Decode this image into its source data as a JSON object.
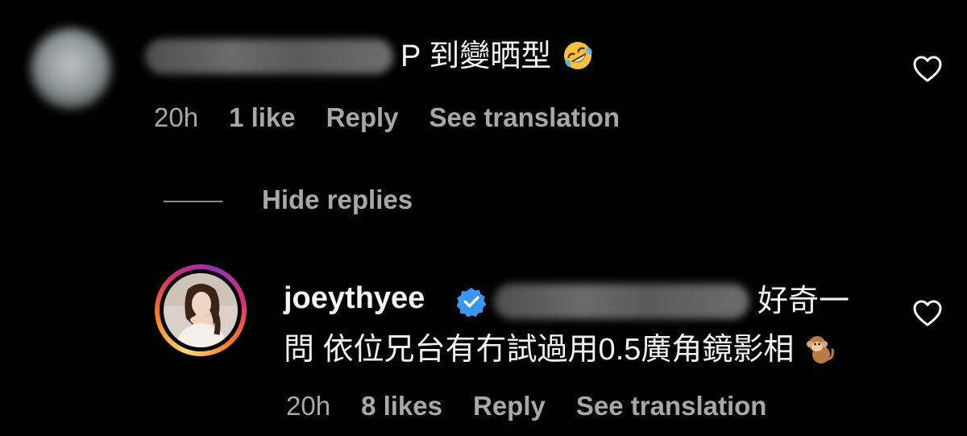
{
  "comment": {
    "text": "P 到變晒型",
    "emoji": "rolling-on-floor-laughing",
    "time": "20h",
    "likes": "1 like",
    "reply_label": "Reply",
    "translate_label": "See translation"
  },
  "hide_replies_label": "Hide replies",
  "reply": {
    "username": "joeythyee",
    "verified": true,
    "text_line1": "好奇一",
    "text_line2": "問 依位兄台有冇試過用0.5廣角鏡影相",
    "emoji": "monkey",
    "time": "20h",
    "likes": "8 likes",
    "reply_label": "Reply",
    "translate_label": "See translation"
  },
  "colors": {
    "background": "#000000",
    "primary_text": "#f5f5f5",
    "secondary_text": "#a8a8a8",
    "verified_blue": "#3897f0"
  }
}
